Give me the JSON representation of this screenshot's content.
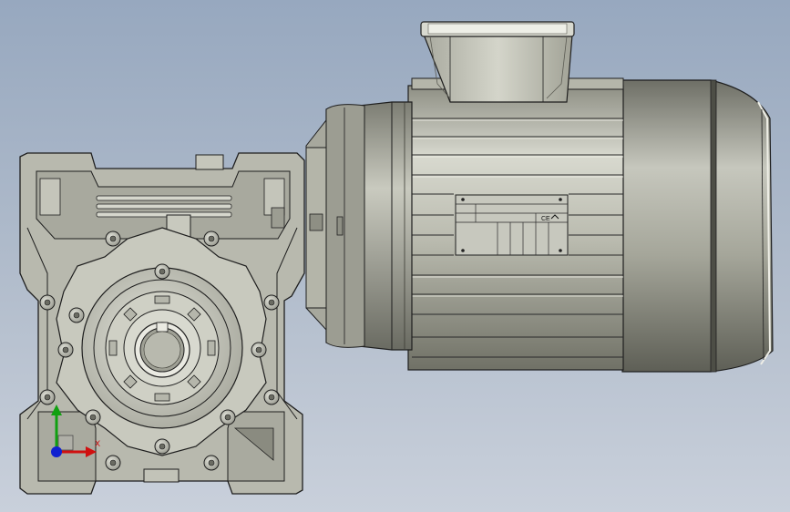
{
  "viewport": {
    "background_top": "#97a8bf",
    "background_bottom": "#c9d0db"
  },
  "model": {
    "parts": [
      "worm-gearbox",
      "motor-adapter",
      "electric-motor",
      "terminal-box",
      "fan-cover",
      "nameplate"
    ],
    "body_color": "#b7b8ad",
    "edge_color": "#1e1e1e"
  },
  "nameplate": {
    "ce_mark": "CE"
  },
  "triad": {
    "x_label": "X",
    "x_color": "#d01010",
    "y_color": "#10a010",
    "z_color": "#1020d0"
  }
}
